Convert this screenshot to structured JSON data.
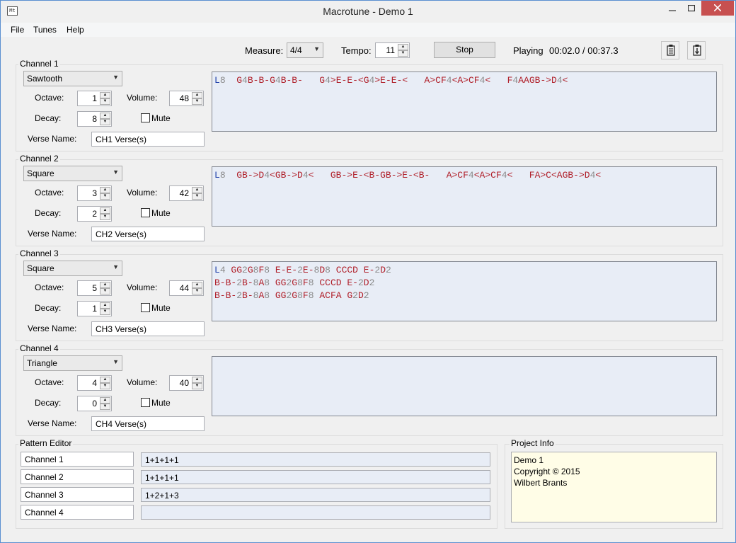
{
  "window": {
    "title": "Macrotune - Demo 1",
    "app_icon": "Mt"
  },
  "menu": [
    "File",
    "Tunes",
    "Help"
  ],
  "toolbar": {
    "measure_label": "Measure:",
    "measure_value": "4/4",
    "tempo_label": "Tempo:",
    "tempo_value": "11",
    "stop_label": "Stop",
    "playing_label": "Playing",
    "time": "00:02.0 / 00:37.3"
  },
  "labels": {
    "octave": "Octave:",
    "volume": "Volume:",
    "decay": "Decay:",
    "mute": "Mute",
    "verse_name": "Verse Name:"
  },
  "channels": [
    {
      "title": "Channel 1",
      "waveform": "Sawtooth",
      "octave": "1",
      "volume": "48",
      "decay": "8",
      "muted": false,
      "verse_name": "CH1 Verse(s)",
      "code": [
        [
          [
            "L",
            "L"
          ],
          [
            "8",
            "n"
          ],
          [
            "  ",
            "a"
          ],
          [
            "G",
            "a"
          ],
          [
            "4",
            "n"
          ],
          [
            "B-B-G",
            "a"
          ],
          [
            "4",
            "n"
          ],
          [
            "B-B-   G",
            "a"
          ],
          [
            "4",
            "n"
          ],
          [
            ">E-E-<G",
            "a"
          ],
          [
            "4",
            "n"
          ],
          [
            ">E-E-<   A>CF",
            "a"
          ],
          [
            "4",
            "n"
          ],
          [
            "<A>CF",
            "a"
          ],
          [
            "4",
            "n"
          ],
          [
            "<   F",
            "a"
          ],
          [
            "4",
            "n"
          ],
          [
            "AAGB->D",
            "a"
          ],
          [
            "4",
            "n"
          ],
          [
            "<",
            "a"
          ]
        ]
      ]
    },
    {
      "title": "Channel 2",
      "waveform": "Square",
      "octave": "3",
      "volume": "42",
      "decay": "2",
      "muted": false,
      "verse_name": "CH2 Verse(s)",
      "code": [
        [
          [
            "L",
            "L"
          ],
          [
            "8",
            "n"
          ],
          [
            "  GB->D",
            "a"
          ],
          [
            "4",
            "n"
          ],
          [
            "<GB->D",
            "a"
          ],
          [
            "4",
            "n"
          ],
          [
            "<   GB->E-<B-GB->E-<B-   A>CF",
            "a"
          ],
          [
            "4",
            "n"
          ],
          [
            "<A>CF",
            "a"
          ],
          [
            "4",
            "n"
          ],
          [
            "<   FA>C<AGB->D",
            "a"
          ],
          [
            "4",
            "n"
          ],
          [
            "<",
            "a"
          ]
        ]
      ]
    },
    {
      "title": "Channel 3",
      "waveform": "Square",
      "octave": "5",
      "volume": "44",
      "decay": "1",
      "muted": false,
      "verse_name": "CH3 Verse(s)",
      "code": [
        [
          [
            "L",
            "L"
          ],
          [
            "4",
            "n"
          ],
          [
            " GG",
            "a"
          ],
          [
            "2",
            "n"
          ],
          [
            "G",
            "a"
          ],
          [
            "8",
            "n"
          ],
          [
            "F",
            "a"
          ],
          [
            "8",
            "n"
          ],
          [
            " E-E-",
            "a"
          ],
          [
            "2",
            "n"
          ],
          [
            "E-",
            "a"
          ],
          [
            "8",
            "n"
          ],
          [
            "D",
            "a"
          ],
          [
            "8",
            "n"
          ],
          [
            " CCCD E-",
            "a"
          ],
          [
            "2",
            "n"
          ],
          [
            "D",
            "a"
          ],
          [
            "2",
            "n"
          ]
        ],
        [
          [
            "B-B-",
            "a"
          ],
          [
            "2",
            "n"
          ],
          [
            "B-",
            "a"
          ],
          [
            "8",
            "n"
          ],
          [
            "A",
            "a"
          ],
          [
            "8",
            "n"
          ],
          [
            " GG",
            "a"
          ],
          [
            "2",
            "n"
          ],
          [
            "G",
            "a"
          ],
          [
            "8",
            "n"
          ],
          [
            "F",
            "a"
          ],
          [
            "8",
            "n"
          ],
          [
            " CCCD E-",
            "a"
          ],
          [
            "2",
            "n"
          ],
          [
            "D",
            "a"
          ],
          [
            "2",
            "n"
          ]
        ],
        [
          [
            "B-B-",
            "a"
          ],
          [
            "2",
            "n"
          ],
          [
            "B-",
            "a"
          ],
          [
            "8",
            "n"
          ],
          [
            "A",
            "a"
          ],
          [
            "8",
            "n"
          ],
          [
            " GG",
            "a"
          ],
          [
            "2",
            "n"
          ],
          [
            "G",
            "a"
          ],
          [
            "8",
            "n"
          ],
          [
            "F",
            "a"
          ],
          [
            "8",
            "n"
          ],
          [
            " ACFA G",
            "a"
          ],
          [
            "2",
            "n"
          ],
          [
            "D",
            "a"
          ],
          [
            "2",
            "n"
          ]
        ]
      ]
    },
    {
      "title": "Channel 4",
      "waveform": "Triangle",
      "octave": "4",
      "volume": "40",
      "decay": "0",
      "muted": false,
      "verse_name": "CH4 Verse(s)",
      "code": []
    }
  ],
  "pattern_editor": {
    "title": "Pattern Editor",
    "rows": [
      {
        "name": "Channel 1",
        "pattern": "1+1+1+1"
      },
      {
        "name": "Channel 2",
        "pattern": "1+1+1+1"
      },
      {
        "name": "Channel 3",
        "pattern": "1+2+1+3"
      },
      {
        "name": "Channel 4",
        "pattern": ""
      }
    ]
  },
  "project_info": {
    "title": "Project Info",
    "lines": [
      "Demo 1",
      "Copyright © 2015",
      "Wilbert Brants"
    ]
  }
}
